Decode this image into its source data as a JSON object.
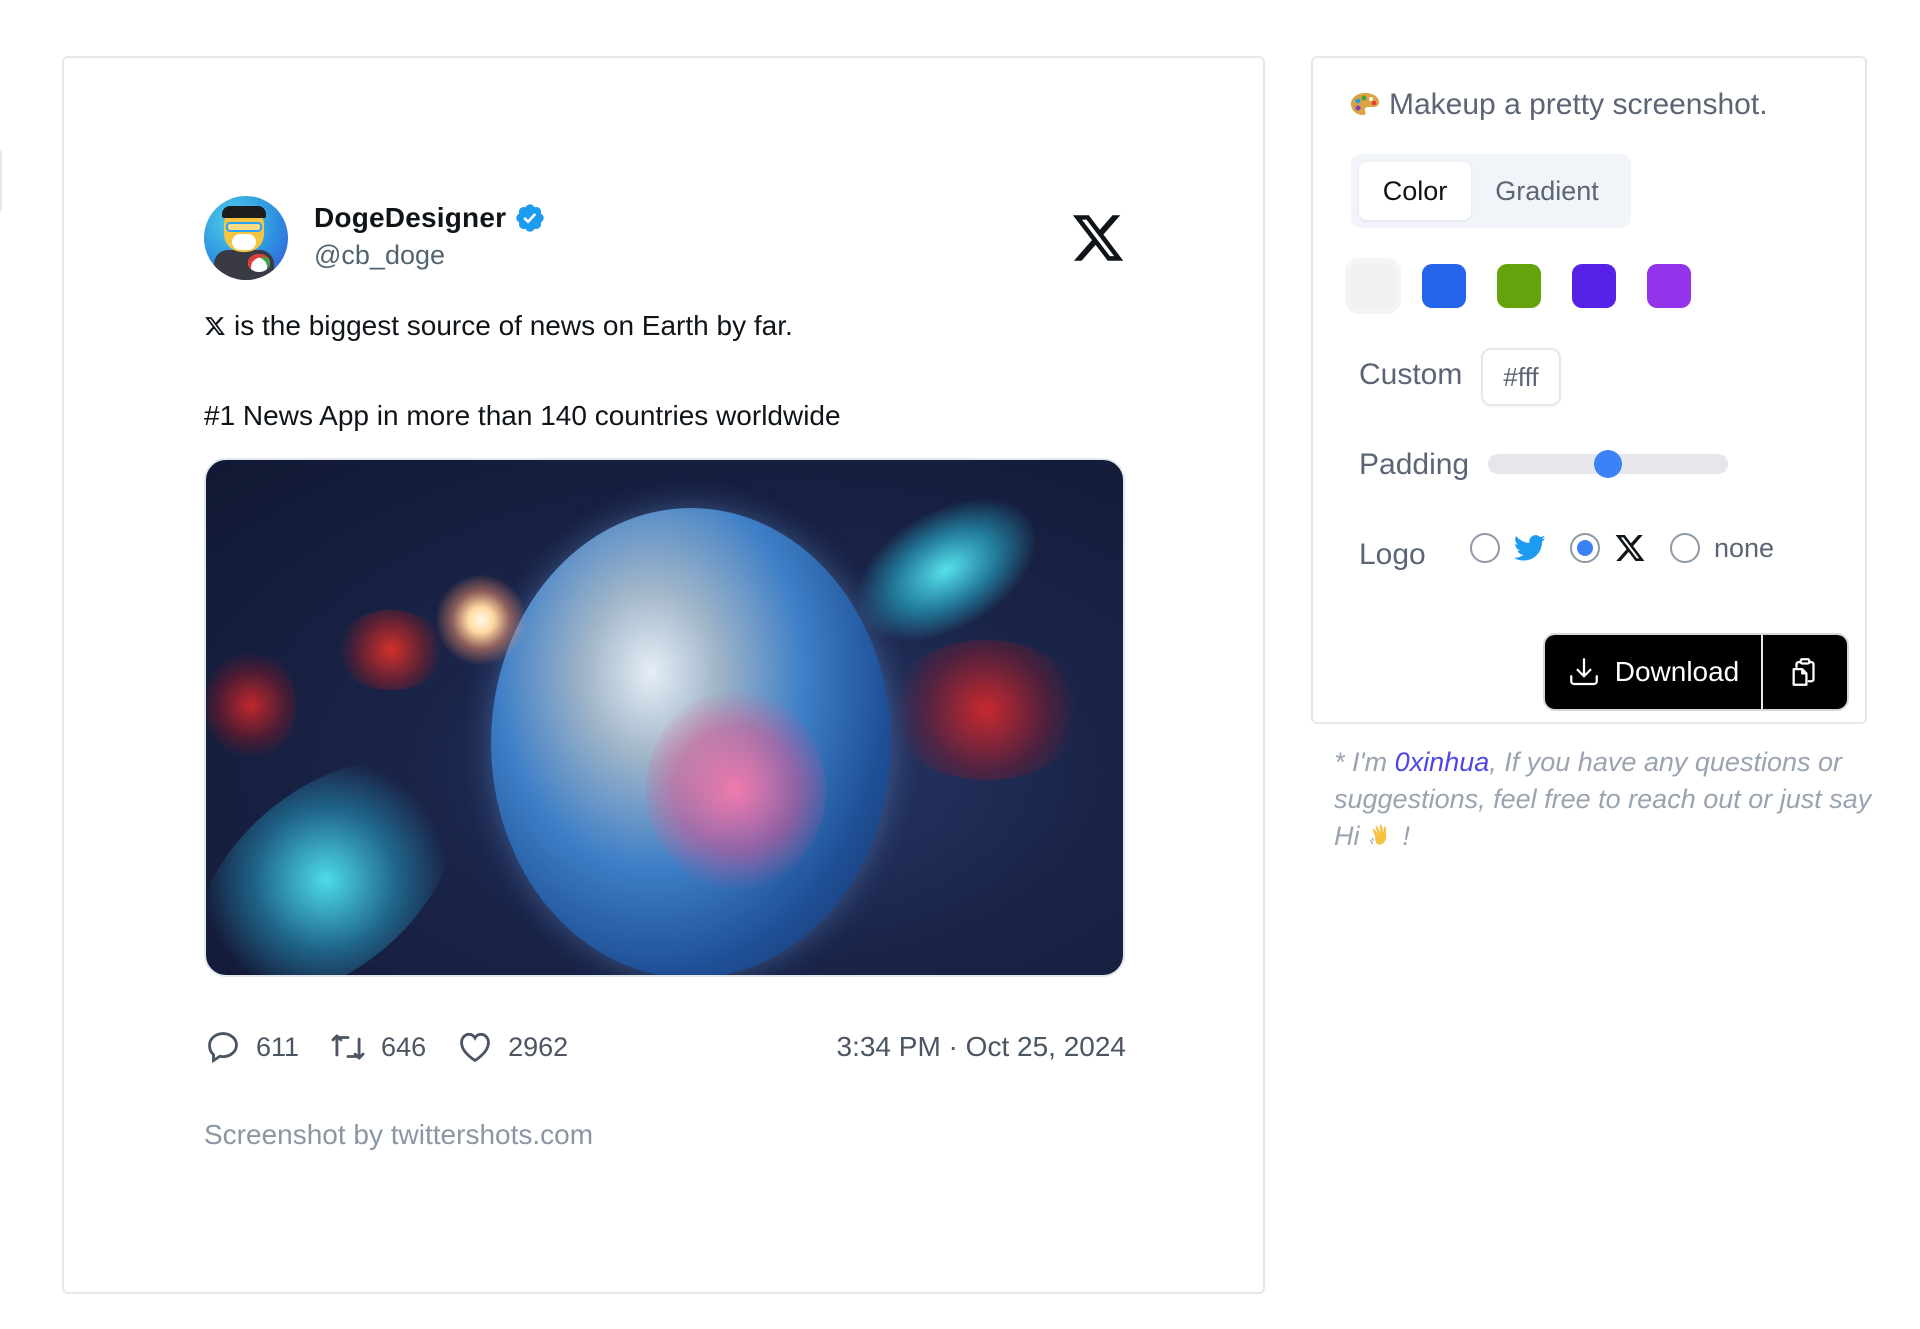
{
  "tweet": {
    "display_name": "DogeDesigner",
    "handle": "@cb_doge",
    "verified": true,
    "brand_logo": "x-logo-icon",
    "text_line_1": "is the biggest source of news on Earth by far.",
    "text_line_1_prefix_icon": "x-logo-icon",
    "text_line_2": "#1 News App in more than 140 countries worldwide",
    "media_description": "Earth in space with nebulae and a bright sun",
    "stats": {
      "replies": "611",
      "retweets": "646",
      "likes": "2962"
    },
    "timestamp": "3:34 PM · Oct 25, 2024",
    "credit": "Screenshot by twittershots.com"
  },
  "panel": {
    "title": "Makeup a pretty screenshot.",
    "title_icon": "artist-palette-icon",
    "tabs": [
      {
        "label": "Color",
        "active": true
      },
      {
        "label": "Gradient",
        "active": false
      }
    ],
    "swatches": [
      {
        "color": "#f1f1f1",
        "selected": true
      },
      {
        "color": "#2563eb",
        "selected": false
      },
      {
        "color": "#65a30d",
        "selected": false
      },
      {
        "color": "#5521e6",
        "selected": false
      },
      {
        "color": "#9333ea",
        "selected": false
      }
    ],
    "custom_label": "Custom",
    "custom_value": "#fff",
    "padding_label": "Padding",
    "padding_value_fraction": 0.5,
    "logo_label": "Logo",
    "logo_options": [
      {
        "icon": "twitter-bird-icon",
        "checked": false
      },
      {
        "icon": "x-logo-icon",
        "checked": true
      },
      {
        "label": "none",
        "checked": false
      }
    ],
    "download_label": "Download",
    "copy_icon": "clipboard-copy-icon"
  },
  "note": {
    "prefix": "* I'm ",
    "author_link": "0xinhua",
    "middle": ", If you have any questions or suggestions, feel free to reach out or just say Hi",
    "suffix": " !"
  },
  "colors": {
    "accent": "#3b82f6",
    "link": "#4f46e5",
    "verified": "#1d9bf0",
    "twitter_blue": "#1d9bf0"
  }
}
